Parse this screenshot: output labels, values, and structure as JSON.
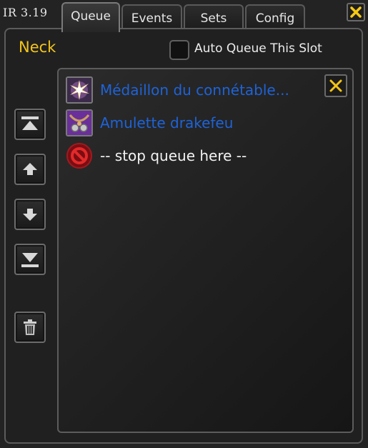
{
  "app": {
    "version": "IR 3.19"
  },
  "tabs": [
    {
      "label": "Queue",
      "active": true
    },
    {
      "label": "Events",
      "active": false
    },
    {
      "label": "Sets",
      "active": false
    },
    {
      "label": "Config",
      "active": false
    }
  ],
  "slot": {
    "title": "Neck"
  },
  "auto_queue": {
    "label": "Auto Queue This Slot",
    "checked": false
  },
  "sidebar": {
    "buttons": [
      {
        "name": "move-to-top",
        "icon": "arrow-to-top-icon"
      },
      {
        "name": "move-up",
        "icon": "arrow-up-icon"
      },
      {
        "name": "move-down",
        "icon": "arrow-down-icon"
      },
      {
        "name": "move-to-bottom",
        "icon": "arrow-to-bottom-icon"
      },
      {
        "name": "delete",
        "icon": "trash-icon"
      }
    ]
  },
  "queue": {
    "items": [
      {
        "label": "Médaillon du connétable...",
        "color": "#1e63d8",
        "icon": "starburst-medallion-icon"
      },
      {
        "label": "Amulette drakefeu",
        "color": "#1e63d8",
        "icon": "amulet-icon"
      },
      {
        "label": "-- stop queue here --",
        "color": "#f2f2f2",
        "icon": "stop-icon"
      }
    ]
  },
  "colors": {
    "accent": "#f3c418",
    "item_text": "#1e63d8",
    "panel": "#202020"
  }
}
